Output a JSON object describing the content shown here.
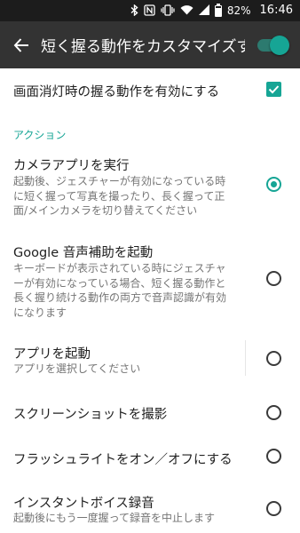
{
  "status_bar": {
    "bluetooth_icon": "bluetooth-icon",
    "nfc_icon": "nfc-icon",
    "vibrate_icon": "vibrate-icon",
    "wifi_icon": "wifi-icon",
    "signal_icon": "signal-icon",
    "battery_percent": "82%",
    "time": "16:46"
  },
  "toolbar": {
    "title": "短く握る動作をカスタマイズす",
    "master_switch_on": true
  },
  "settings": {
    "screen_off": {
      "label": "画面消灯時の握る動作を有効にする",
      "checked": true
    },
    "section_header": "アクション",
    "options": [
      {
        "title": "カメラアプリを実行",
        "summary": [
          "起動後、ジェスチャーが有効になっている時",
          "に短く握って写真を撮ったり、長く握って正",
          "面/メインカメラを切り替えてください"
        ],
        "selected": true
      },
      {
        "title": "Google 音声補助を起動",
        "summary": [
          "キーボードが表示されている時にジェスチャ",
          "ーが有効になっている場合、短く握る動作と",
          "長く握り続ける動作の両方で音声認識が有効",
          "になります"
        ],
        "selected": false
      },
      {
        "title": "アプリを起動",
        "summary": [
          "アプリを選択してください"
        ],
        "selected": false
      },
      {
        "title": "スクリーンショットを撮影",
        "summary": [],
        "selected": false
      },
      {
        "title": "フラッシュライトをオン／オフにする",
        "summary": [],
        "selected": false
      },
      {
        "title": "インスタントボイス録音",
        "summary": [
          "起動後にもう一度握って録音を中止します"
        ],
        "selected": false
      }
    ]
  },
  "colors": {
    "accent": "#16a595",
    "toolbar": "#333333",
    "status_bar": "#1c1c1c"
  }
}
